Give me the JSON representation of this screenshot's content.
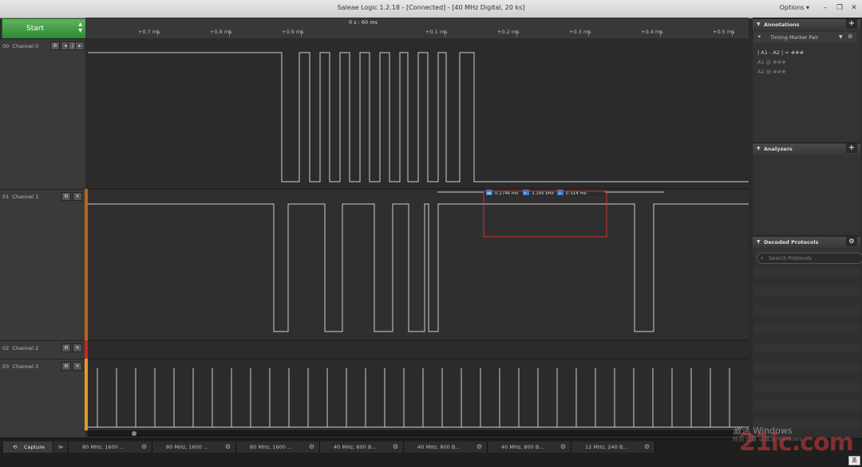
{
  "window": {
    "title": "Saleae Logic 1.2.18 - [Connected] - [40 MHz Digital, 20 ks]",
    "options_label": "Options ▾",
    "min_icon": "minimize-icon",
    "max_icon": "restore-icon",
    "close_icon": "close-icon"
  },
  "start_button": {
    "label": "Start"
  },
  "ruler": {
    "center_label": "0 s : 60 ms",
    "ticks": [
      "+0.7 ms",
      "+0.8 ms",
      "+0.9 ms",
      "+0.1 ms",
      "+0.2 ms",
      "+0.3 ms",
      "+0.4 ms",
      "+0.5 ms"
    ]
  },
  "channels": [
    {
      "index": "00",
      "name": "Channel 0",
      "color": "#5a5a5a"
    },
    {
      "index": "01",
      "name": "Channel 1",
      "color": "#b8651b"
    },
    {
      "index": "02",
      "name": "Channel 2",
      "color": "#d02020"
    },
    {
      "index": "03",
      "name": "Channel 3",
      "color": "#e39a1b"
    }
  ],
  "measurement": {
    "width_label": "W",
    "width_value": "0.2746 ms",
    "freq_label": "f",
    "freq_value": "3.185 kHz",
    "period_label": "T",
    "period_value": "0.314 ms"
  },
  "annotations": {
    "title": "Annotations",
    "pair_label": "Timing Marker Pair",
    "row1": "| A1 - A2 | = ###",
    "row2": "A1  @  ###",
    "row3": "A2  @  ###"
  },
  "analyzers": {
    "title": "Analyzers"
  },
  "decoded": {
    "title": "Decoded Protocols",
    "search_placeholder": "Search Protocols"
  },
  "bottom_tabs": [
    {
      "label": "Capture"
    },
    {
      "label": "80 MHz, 1600 ..."
    },
    {
      "label": "80 MHz, 1600 ..."
    },
    {
      "label": "80 MHz, 1600 ..."
    },
    {
      "label": "40 MHz, 800 B..."
    },
    {
      "label": "40 MHz, 800 B..."
    },
    {
      "label": "40 MHz, 800 B..."
    },
    {
      "label": "12 MHz, 240 B..."
    }
  ],
  "watermark": {
    "line1": "激活 Windows",
    "line2": "转到 设置 以激活 Windows",
    "logo": "21ic.com"
  },
  "ime": "英"
}
